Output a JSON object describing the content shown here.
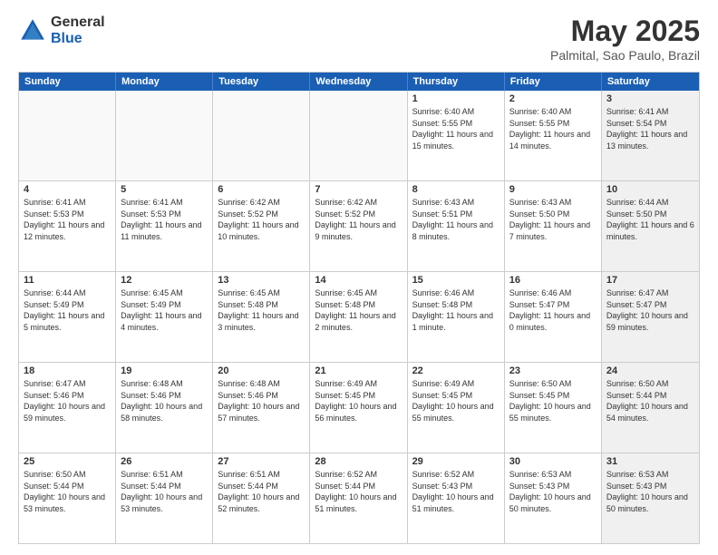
{
  "logo": {
    "general": "General",
    "blue": "Blue"
  },
  "header": {
    "month": "May 2025",
    "location": "Palmital, Sao Paulo, Brazil"
  },
  "days_of_week": [
    "Sunday",
    "Monday",
    "Tuesday",
    "Wednesday",
    "Thursday",
    "Friday",
    "Saturday"
  ],
  "rows": [
    [
      {
        "day": "",
        "info": "",
        "empty": true
      },
      {
        "day": "",
        "info": "",
        "empty": true
      },
      {
        "day": "",
        "info": "",
        "empty": true
      },
      {
        "day": "",
        "info": "",
        "empty": true
      },
      {
        "day": "1",
        "info": "Sunrise: 6:40 AM\nSunset: 5:55 PM\nDaylight: 11 hours and 15 minutes."
      },
      {
        "day": "2",
        "info": "Sunrise: 6:40 AM\nSunset: 5:55 PM\nDaylight: 11 hours and 14 minutes."
      },
      {
        "day": "3",
        "info": "Sunrise: 6:41 AM\nSunset: 5:54 PM\nDaylight: 11 hours and 13 minutes.",
        "shaded": true
      }
    ],
    [
      {
        "day": "4",
        "info": "Sunrise: 6:41 AM\nSunset: 5:53 PM\nDaylight: 11 hours and 12 minutes."
      },
      {
        "day": "5",
        "info": "Sunrise: 6:41 AM\nSunset: 5:53 PM\nDaylight: 11 hours and 11 minutes."
      },
      {
        "day": "6",
        "info": "Sunrise: 6:42 AM\nSunset: 5:52 PM\nDaylight: 11 hours and 10 minutes."
      },
      {
        "day": "7",
        "info": "Sunrise: 6:42 AM\nSunset: 5:52 PM\nDaylight: 11 hours and 9 minutes."
      },
      {
        "day": "8",
        "info": "Sunrise: 6:43 AM\nSunset: 5:51 PM\nDaylight: 11 hours and 8 minutes."
      },
      {
        "day": "9",
        "info": "Sunrise: 6:43 AM\nSunset: 5:50 PM\nDaylight: 11 hours and 7 minutes."
      },
      {
        "day": "10",
        "info": "Sunrise: 6:44 AM\nSunset: 5:50 PM\nDaylight: 11 hours and 6 minutes.",
        "shaded": true
      }
    ],
    [
      {
        "day": "11",
        "info": "Sunrise: 6:44 AM\nSunset: 5:49 PM\nDaylight: 11 hours and 5 minutes."
      },
      {
        "day": "12",
        "info": "Sunrise: 6:45 AM\nSunset: 5:49 PM\nDaylight: 11 hours and 4 minutes."
      },
      {
        "day": "13",
        "info": "Sunrise: 6:45 AM\nSunset: 5:48 PM\nDaylight: 11 hours and 3 minutes."
      },
      {
        "day": "14",
        "info": "Sunrise: 6:45 AM\nSunset: 5:48 PM\nDaylight: 11 hours and 2 minutes."
      },
      {
        "day": "15",
        "info": "Sunrise: 6:46 AM\nSunset: 5:48 PM\nDaylight: 11 hours and 1 minute."
      },
      {
        "day": "16",
        "info": "Sunrise: 6:46 AM\nSunset: 5:47 PM\nDaylight: 11 hours and 0 minutes."
      },
      {
        "day": "17",
        "info": "Sunrise: 6:47 AM\nSunset: 5:47 PM\nDaylight: 10 hours and 59 minutes.",
        "shaded": true
      }
    ],
    [
      {
        "day": "18",
        "info": "Sunrise: 6:47 AM\nSunset: 5:46 PM\nDaylight: 10 hours and 59 minutes."
      },
      {
        "day": "19",
        "info": "Sunrise: 6:48 AM\nSunset: 5:46 PM\nDaylight: 10 hours and 58 minutes."
      },
      {
        "day": "20",
        "info": "Sunrise: 6:48 AM\nSunset: 5:46 PM\nDaylight: 10 hours and 57 minutes."
      },
      {
        "day": "21",
        "info": "Sunrise: 6:49 AM\nSunset: 5:45 PM\nDaylight: 10 hours and 56 minutes."
      },
      {
        "day": "22",
        "info": "Sunrise: 6:49 AM\nSunset: 5:45 PM\nDaylight: 10 hours and 55 minutes."
      },
      {
        "day": "23",
        "info": "Sunrise: 6:50 AM\nSunset: 5:45 PM\nDaylight: 10 hours and 55 minutes."
      },
      {
        "day": "24",
        "info": "Sunrise: 6:50 AM\nSunset: 5:44 PM\nDaylight: 10 hours and 54 minutes.",
        "shaded": true
      }
    ],
    [
      {
        "day": "25",
        "info": "Sunrise: 6:50 AM\nSunset: 5:44 PM\nDaylight: 10 hours and 53 minutes."
      },
      {
        "day": "26",
        "info": "Sunrise: 6:51 AM\nSunset: 5:44 PM\nDaylight: 10 hours and 53 minutes."
      },
      {
        "day": "27",
        "info": "Sunrise: 6:51 AM\nSunset: 5:44 PM\nDaylight: 10 hours and 52 minutes."
      },
      {
        "day": "28",
        "info": "Sunrise: 6:52 AM\nSunset: 5:44 PM\nDaylight: 10 hours and 51 minutes."
      },
      {
        "day": "29",
        "info": "Sunrise: 6:52 AM\nSunset: 5:43 PM\nDaylight: 10 hours and 51 minutes."
      },
      {
        "day": "30",
        "info": "Sunrise: 6:53 AM\nSunset: 5:43 PM\nDaylight: 10 hours and 50 minutes."
      },
      {
        "day": "31",
        "info": "Sunrise: 6:53 AM\nSunset: 5:43 PM\nDaylight: 10 hours and 50 minutes.",
        "shaded": true
      }
    ]
  ]
}
